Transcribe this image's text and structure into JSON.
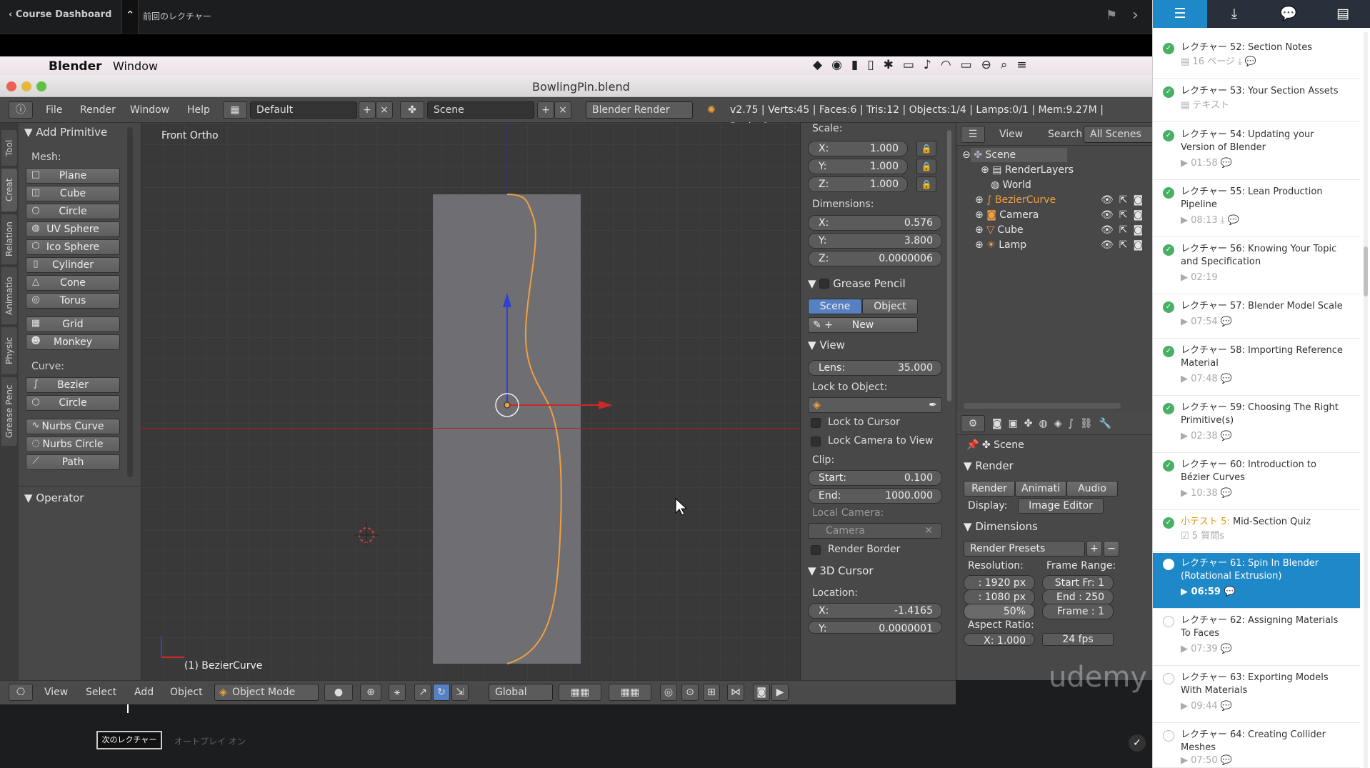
{
  "topbar": {
    "back": "Course Dashboard",
    "prev": "前回のレクチャー"
  },
  "mac": {
    "app": "Blender",
    "window": "Window"
  },
  "window_title": "BowlingPin.blend",
  "info": {
    "menus": [
      "File",
      "Render",
      "Window",
      "Help"
    ],
    "layout": "Default",
    "scene": "Scene",
    "engine": "Blender Render",
    "stats": "v2.75 | Verts:45 | Faces:6 | Tris:12 | Objects:1/4 | Lamps:0/1 | Mem:9.27M | BezierCurve"
  },
  "tabs": [
    "Tool",
    "Creat",
    "Relation",
    "Animatio",
    "Physic",
    "Grease Penc"
  ],
  "shelf": {
    "panel": "Add Primitive",
    "mesh_label": "Mesh:",
    "mesh": [
      "Plane",
      "Cube",
      "Circle",
      "UV Sphere",
      "Ico Sphere",
      "Cylinder",
      "Cone",
      "Torus",
      "Grid",
      "Monkey"
    ],
    "curve_label": "Curve:",
    "curve": [
      "Bezier",
      "Circle",
      "Nurbs Curve",
      "Nurbs Circle",
      "Path"
    ],
    "operator": "Operator"
  },
  "viewport": {
    "view_name": "Front Ortho",
    "object_name": "(1) BezierCurve"
  },
  "npanel": {
    "scale_label": "Scale:",
    "scale": {
      "x": "1.000",
      "y": "1.000",
      "z": "1.000"
    },
    "dimensions_label": "Dimensions:",
    "dimensions": {
      "x": "0.576",
      "y": "3.800",
      "z": "0.0000006"
    },
    "grease_pencil": "Grease Pencil",
    "gp_scene": "Scene",
    "gp_object": "Object",
    "gp_new": "New",
    "view": "View",
    "lens_label": "Lens:",
    "lens": "35.000",
    "lock_to_object": "Lock to Object:",
    "lock_cursor": "Lock to Cursor",
    "lock_camera": "Lock Camera to View",
    "clip_label": "Clip:",
    "clip_start_label": "Start:",
    "clip_start": "0.100",
    "clip_end_label": "End:",
    "clip_end": "1000.000",
    "local_camera": "Local Camera:",
    "camera": "Camera",
    "render_border": "Render Border",
    "cursor": "3D Cursor",
    "location": "Location:",
    "loc_x": "-1.4165",
    "loc_y": "0.0000001",
    "axis_x": "X:",
    "axis_y": "Y:",
    "axis_z": "Z:"
  },
  "outliner": {
    "view": "View",
    "search": "Search",
    "all_scenes": "All Scenes",
    "items": [
      "Scene",
      "RenderLayers",
      "World",
      "BezierCurve",
      "Camera",
      "Cube",
      "Lamp"
    ]
  },
  "props": {
    "scene": "Scene",
    "render": "Render",
    "btn_render": "Render",
    "btn_anim": "Animati",
    "btn_audio": "Audio",
    "display_label": "Display:",
    "display": "Image Editor",
    "dimensions": "Dimensions",
    "presets": "Render Presets",
    "resolution": "Resolution:",
    "frame_range": "Frame Range:",
    "res_x": ": 1920 px",
    "res_y": ": 1080 px",
    "res_pct": "50%",
    "start": "Start Fr: 1",
    "end": "End : 250",
    "frame": "Frame : 1",
    "aspect": "Aspect Ratio:",
    "aspect_x": "X:  1.000",
    "fps": "24 fps"
  },
  "bottom": {
    "menus": [
      "View",
      "Select",
      "Add",
      "Object"
    ],
    "mode": "Object Mode",
    "orientation": "Global"
  },
  "below": {
    "next": "次のレクチャー",
    "autoplay": "オートプレイ オン"
  },
  "watermark": "udemy",
  "lectures": [
    {
      "title": "レクチャー 52: Section Notes",
      "meta": "16 ページ",
      "state": "done"
    },
    {
      "title": "レクチャー 53: Your Section Assets",
      "meta": "テキスト",
      "state": "done"
    },
    {
      "title": "レクチャー 54: Updating your Version of Blender",
      "meta": "01:58",
      "state": "done"
    },
    {
      "title": "レクチャー 55: Lean Production Pipeline",
      "meta": "08:13",
      "state": "done"
    },
    {
      "title": "レクチャー 56: Knowing Your Topic and Specification",
      "meta": "02:19",
      "state": "done"
    },
    {
      "title": "レクチャー 57: Blender Model Scale",
      "meta": "07:54",
      "state": "done"
    },
    {
      "title": "レクチャー 58: Importing Reference Material",
      "meta": "07:48",
      "state": "done"
    },
    {
      "title": "レクチャー 59: Choosing The Right Primitive(s)",
      "meta": "02:38",
      "state": "done"
    },
    {
      "title": "レクチャー 60: Introduction to Bézier Curves",
      "meta": "10:38",
      "state": "done"
    },
    {
      "title": "Mid-Section Quiz",
      "quiz_prefix": "小テスト 5:",
      "meta": "5 質問s",
      "state": "done"
    },
    {
      "title": "レクチャー 61: Spin In Blender (Rotational Extrusion)",
      "meta": "06:59",
      "state": "active"
    },
    {
      "title": "レクチャー 62: Assigning Materials To Faces",
      "meta": "07:39",
      "state": "todo"
    },
    {
      "title": "レクチャー 63: Exporting Models With Materials",
      "meta": "09:44",
      "state": "todo"
    },
    {
      "title": "レクチャー 64: Creating Collider Meshes",
      "meta": "07:50",
      "state": "todo"
    }
  ]
}
